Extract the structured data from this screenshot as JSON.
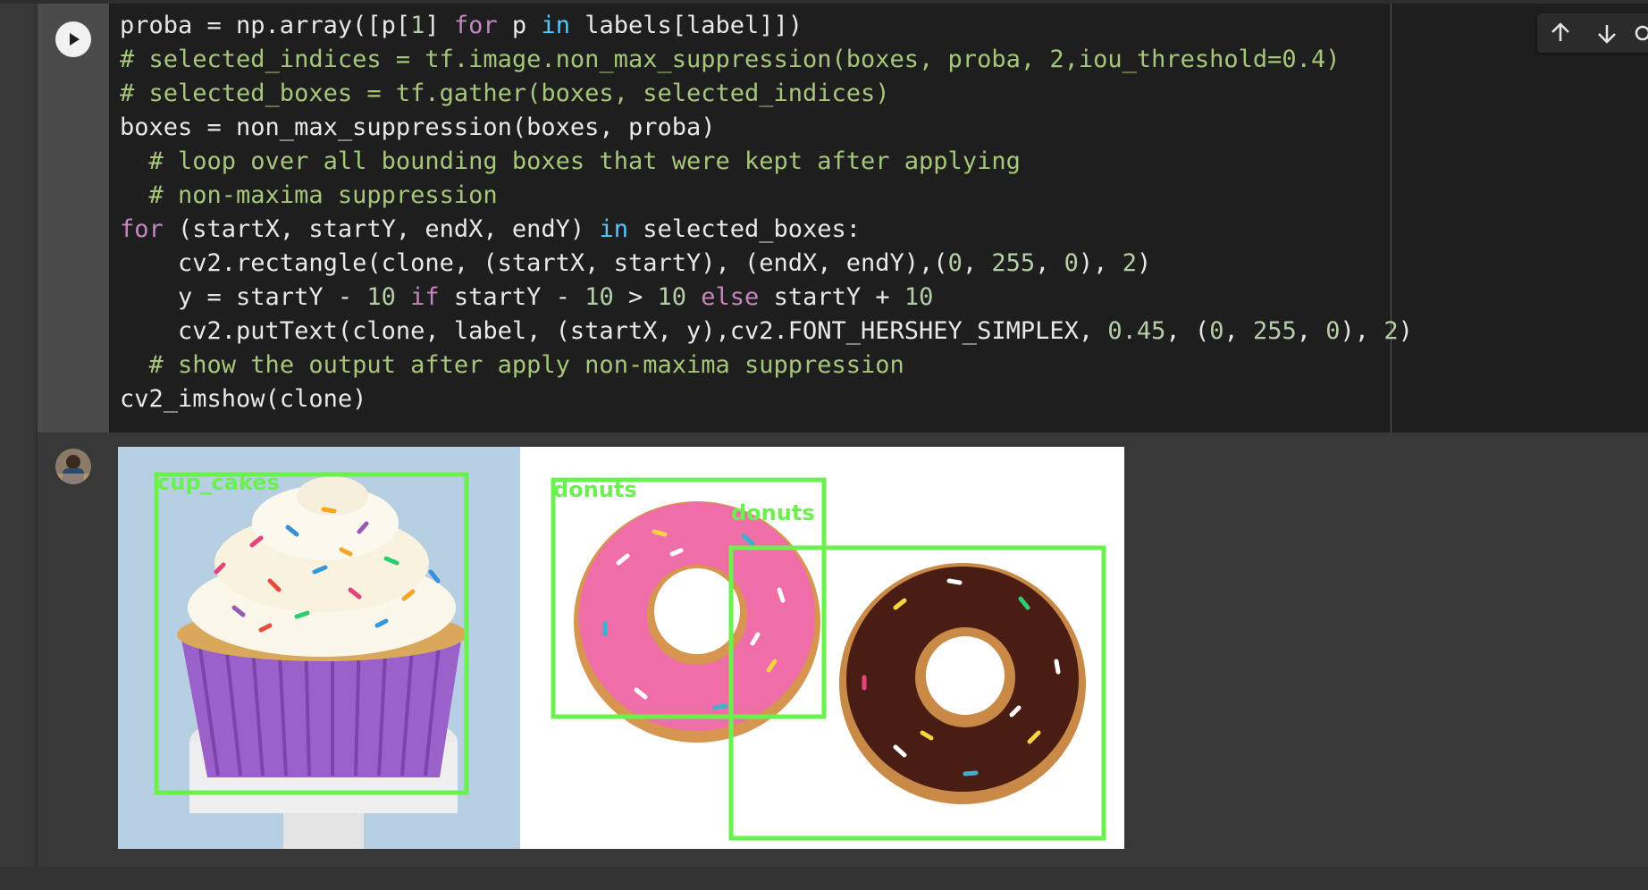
{
  "cell": {
    "code_lines": [
      [
        [
          "plain",
          "proba = np.array([p["
        ],
        [
          "num",
          "1"
        ],
        [
          "plain",
          "] "
        ],
        [
          "kw",
          "for"
        ],
        [
          "plain",
          " p "
        ],
        [
          "in",
          "in"
        ],
        [
          "plain",
          " labels[label]])"
        ]
      ],
      [
        [
          "comment",
          "# selected_indices = tf.image.non_max_suppression(boxes, proba, 2,iou_threshold=0.4)"
        ]
      ],
      [
        [
          "comment",
          "# selected_boxes = tf.gather(boxes, selected_indices)"
        ]
      ],
      [
        [
          "plain",
          "boxes = non_max_suppression(boxes, proba)"
        ]
      ],
      [
        [
          "plain",
          "  "
        ],
        [
          "comment",
          "# loop over all bounding boxes that were kept after applying"
        ]
      ],
      [
        [
          "plain",
          "  "
        ],
        [
          "comment",
          "# non-maxima suppression"
        ]
      ],
      [
        [
          "kw",
          "for"
        ],
        [
          "plain",
          " (startX, startY, endX, endY) "
        ],
        [
          "in",
          "in"
        ],
        [
          "plain",
          " selected_boxes:"
        ]
      ],
      [
        [
          "plain",
          "    cv2.rectangle(clone, (startX, startY), (endX, endY),("
        ],
        [
          "num",
          "0"
        ],
        [
          "plain",
          ", "
        ],
        [
          "num",
          "255"
        ],
        [
          "plain",
          ", "
        ],
        [
          "num",
          "0"
        ],
        [
          "plain",
          "), "
        ],
        [
          "num",
          "2"
        ],
        [
          "plain",
          ")"
        ]
      ],
      [
        [
          "plain",
          "    y = startY - "
        ],
        [
          "num",
          "10"
        ],
        [
          "plain",
          " "
        ],
        [
          "kw",
          "if"
        ],
        [
          "plain",
          " startY - "
        ],
        [
          "num",
          "10"
        ],
        [
          "plain",
          " > "
        ],
        [
          "num",
          "10"
        ],
        [
          "plain",
          " "
        ],
        [
          "kw",
          "else"
        ],
        [
          "plain",
          " startY + "
        ],
        [
          "num",
          "10"
        ]
      ],
      [
        [
          "plain",
          "    cv2.putText(clone, label, (startX, y),cv2.FONT_HERSHEY_SIMPLEX, "
        ],
        [
          "num",
          "0.45"
        ],
        [
          "plain",
          ", ("
        ],
        [
          "num",
          "0"
        ],
        [
          "plain",
          ", "
        ],
        [
          "num",
          "255"
        ],
        [
          "plain",
          ", "
        ],
        [
          "num",
          "0"
        ],
        [
          "plain",
          "), "
        ],
        [
          "num",
          "2"
        ],
        [
          "plain",
          ")"
        ]
      ],
      [
        [
          "plain",
          "  "
        ],
        [
          "comment",
          "# show the output after apply non-maxima suppression"
        ]
      ],
      [
        [
          "plain",
          "cv2_imshow(clone)"
        ]
      ]
    ]
  },
  "colors": {
    "editor_bg": "#1e1e1e",
    "comment": "#a6c77a",
    "keyword": "#c586c0",
    "in_keyword": "#4ec9ff",
    "number": "#b5cea8",
    "detection_box": "#6cf04f"
  },
  "toolbar": {
    "icons": [
      "arrow-up-icon",
      "arrow-down-icon"
    ]
  },
  "output": {
    "labels": {
      "cupcake": "cup_cakes",
      "donut_1": "donuts",
      "donut_2": "donuts"
    }
  }
}
